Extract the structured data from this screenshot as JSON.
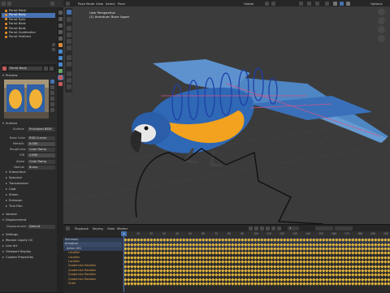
{
  "outliner": {
    "items": [
      {
        "label": "Parrot Mesh",
        "selected": false
      },
      {
        "label": "Parrot Body",
        "selected": true
      },
      {
        "label": "Parrot Eyes",
        "selected": false
      },
      {
        "label": "Parrot Beak",
        "selected": false
      },
      {
        "label": "Parrot Beak",
        "selected": false
      },
      {
        "label": "Parrot Goldfeather",
        "selected": false
      },
      {
        "label": "Parrot Feathers",
        "selected": false
      }
    ]
  },
  "material": {
    "slot_name": "Parrot Body",
    "preview_label": "Preview"
  },
  "properties": {
    "surface_section": "Surface",
    "surface_label": "Surface",
    "surface_value": "Principled BSDF",
    "base_color_label": "Base Color",
    "base_color_value": "RGB Curves",
    "metallic_label": "Metallic",
    "metallic_value": "0.000",
    "roughness_label": "Roughness",
    "roughness_value": "Color Ramp",
    "ior_label": "IOR",
    "ior_value": "1.450",
    "alpha_label": "Alpha",
    "alpha_value": "Color Ramp",
    "normal_label": "Normal",
    "normal_value": "Bump",
    "sections": [
      "Subsurface",
      "Specular",
      "Transmission",
      "Coat",
      "Sheen",
      "Emission",
      "Thin Film"
    ],
    "volume_section": "Volume",
    "displacement_section": "Displacement",
    "displacement_label": "Displacement",
    "displacement_value": "Default",
    "lower_sections": [
      "Settings",
      "Module Liquify Oil",
      "Line Art",
      "Viewport Display",
      "Custom Properties"
    ]
  },
  "viewport": {
    "header_items": [
      "Pose Mode",
      "View",
      "Select",
      "Pose"
    ],
    "right_header": [
      "Global",
      "Options"
    ],
    "view_label": "User Perspective",
    "view_sub": "(1) Armature: Bone Upper"
  },
  "timeline": {
    "header_items": [
      "Playback",
      "Keying",
      "View",
      "Marker"
    ],
    "current_frame": "1",
    "ticks": [
      "0",
      "10",
      "20",
      "30",
      "40",
      "50",
      "60",
      "70",
      "80",
      "90",
      "100",
      "110",
      "120",
      "130",
      "140",
      "150",
      "160",
      "170",
      "180",
      "190",
      "200"
    ],
    "channels": [
      "Summary",
      "Armature",
      "Action 001",
      "Location",
      "Location",
      "Location",
      "Quaternion Rotation",
      "Quaternion Rotation",
      "Quaternion Rotation",
      "Quaternion Rotation",
      "Scale"
    ]
  },
  "colors": {
    "accent": "#4772b3",
    "keyframe": "#e2b43a",
    "channel_text": "#e0a050"
  }
}
